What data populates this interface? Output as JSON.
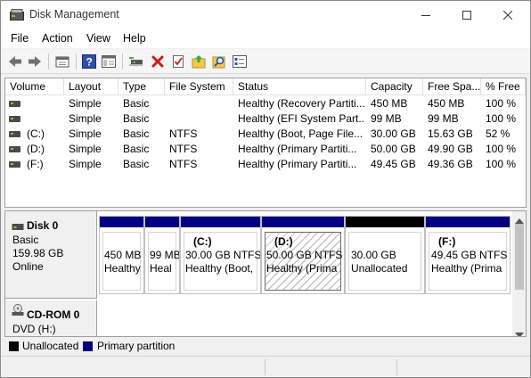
{
  "window": {
    "title": "Disk Management"
  },
  "menu": [
    {
      "label": "File"
    },
    {
      "label": "Action"
    },
    {
      "label": "View"
    },
    {
      "label": "Help"
    }
  ],
  "toolbar_icons": [
    "back-arrow",
    "forward-arrow",
    "up-one-level",
    "help",
    "show-hide-console-tree",
    "connect-drive",
    "delete",
    "properties",
    "open-folder",
    "search",
    "more-options"
  ],
  "columns": [
    "Volume",
    "Layout",
    "Type",
    "File System",
    "Status",
    "Capacity",
    "Free Spa...",
    "% Free"
  ],
  "volumes": [
    {
      "volume": "",
      "layout": "Simple",
      "type": "Basic",
      "fs": "",
      "status": "Healthy (Recovery Partiti...",
      "capacity": "450 MB",
      "free": "450 MB",
      "pct": "100 %"
    },
    {
      "volume": "",
      "layout": "Simple",
      "type": "Basic",
      "fs": "",
      "status": "Healthy (EFI System Part...",
      "capacity": "99 MB",
      "free": "99 MB",
      "pct": "100 %"
    },
    {
      "volume": "(C:)",
      "layout": "Simple",
      "type": "Basic",
      "fs": "NTFS",
      "status": "Healthy (Boot, Page File...",
      "capacity": "30.00 GB",
      "free": "15.63 GB",
      "pct": "52 %"
    },
    {
      "volume": "(D:)",
      "layout": "Simple",
      "type": "Basic",
      "fs": "NTFS",
      "status": "Healthy (Primary Partiti...",
      "capacity": "50.00 GB",
      "free": "49.90 GB",
      "pct": "100 %"
    },
    {
      "volume": "(F:)",
      "layout": "Simple",
      "type": "Basic",
      "fs": "NTFS",
      "status": "Healthy (Primary Partiti...",
      "capacity": "49.45 GB",
      "free": "49.36 GB",
      "pct": "100 %"
    }
  ],
  "disk0": {
    "name": "Disk 0",
    "type": "Basic",
    "size": "159.98 GB",
    "state": "Online",
    "partitions": [
      {
        "title": "",
        "line1": "450 MB",
        "line2": "Healthy",
        "kind": "primary"
      },
      {
        "title": "",
        "line1": "99 MB",
        "line2": "Heal",
        "kind": "primary"
      },
      {
        "title": "(C:)",
        "line1": "30.00 GB NTFS",
        "line2": "Healthy (Boot,",
        "kind": "primary"
      },
      {
        "title": "(D:)",
        "line1": "50.00 GB NTFS",
        "line2": "Healthy (Prima",
        "kind": "primary-selected"
      },
      {
        "title": "",
        "line1": "30.00 GB",
        "line2": "Unallocated",
        "kind": "unallocated"
      },
      {
        "title": "(F:)",
        "line1": "49.45 GB NTFS",
        "line2": "Healthy (Prima",
        "kind": "primary"
      }
    ]
  },
  "cdrom": {
    "name": "CD-ROM 0",
    "desc": "DVD (H:)"
  },
  "legend": [
    {
      "label": "Unallocated",
      "color": "#000000"
    },
    {
      "label": "Primary partition",
      "color": "#000080"
    }
  ],
  "colors": {
    "primary_bar": "#000080",
    "unallocated_bar": "#000000"
  }
}
